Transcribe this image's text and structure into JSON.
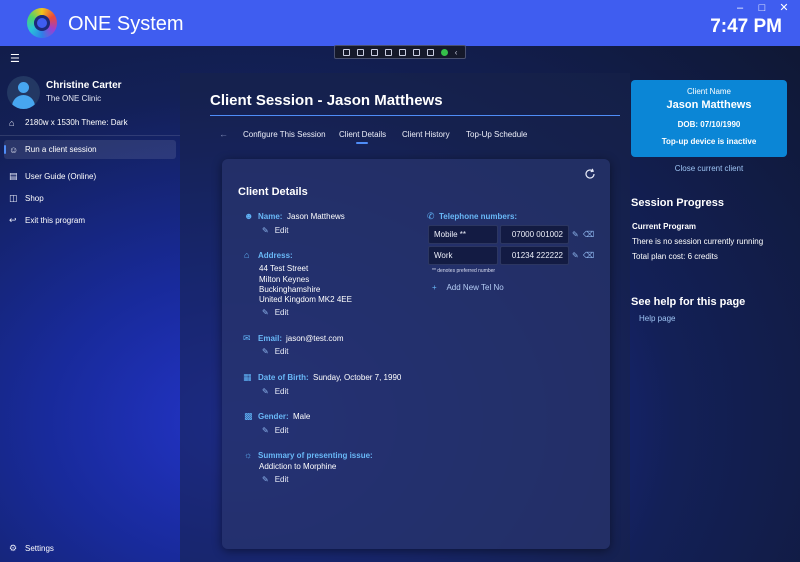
{
  "app": {
    "title": "ONE System",
    "clock": "7:47 PM"
  },
  "sidebar": {
    "user_name": "Christine Carter",
    "clinic": "The ONE Clinic",
    "items": [
      {
        "label": "2180w x 1530h Theme: Dark",
        "icon": "home-icon"
      },
      {
        "label": "Run a client session",
        "icon": "person-settings-icon"
      },
      {
        "label": "User Guide (Online)",
        "icon": "book-icon"
      },
      {
        "label": "Shop",
        "icon": "cart-icon"
      },
      {
        "label": "Exit this program",
        "icon": "exit-icon"
      }
    ],
    "settings_label": "Settings"
  },
  "main": {
    "title": "Client Session - Jason Matthews",
    "tabs": [
      {
        "label": "Configure This Session"
      },
      {
        "label": "Client Details"
      },
      {
        "label": "Client History"
      },
      {
        "label": "Top-Up Schedule"
      }
    ],
    "active_tab": "Client Details",
    "card_title": "Client Details",
    "edit_label": "Edit",
    "fields": {
      "name": {
        "label": "Name:",
        "value": "Jason Matthews"
      },
      "address": {
        "label": "Address:",
        "lines": [
          "44 Test Street",
          "Milton Keynes",
          "Buckinghamshire",
          "United Kingdom MK2 4EE"
        ]
      },
      "email": {
        "label": "Email:",
        "value": "jason@test.com"
      },
      "dob": {
        "label": "Date of Birth:",
        "value": "Sunday, October 7, 1990"
      },
      "gender": {
        "label": "Gender:",
        "value": "Male"
      },
      "issue": {
        "label": "Summary of presenting issue:",
        "value": "Addiction to Morphine"
      }
    },
    "telephone": {
      "label": "Telephone numbers:",
      "rows": [
        {
          "type": "Mobile **",
          "number": "07000 001002"
        },
        {
          "type": "Work",
          "number": "01234 222222"
        }
      ],
      "note": "** denotes preferred number",
      "add_label": "Add New Tel No"
    }
  },
  "client_card": {
    "heading": "Client Name",
    "name": "Jason Matthews",
    "dob": "DOB: 07/10/1990",
    "topup": "Top-up device is inactive",
    "close_label": "Close current client"
  },
  "session_progress": {
    "title": "Session Progress",
    "subtitle": "Current Program",
    "status": "There is no session currently running",
    "cost": "Total plan cost: 6 credits"
  },
  "help": {
    "title": "See help for this page",
    "link": "Help page"
  },
  "colors": {
    "titlebar": "#3f5df0",
    "accent": "#4f8df7",
    "label_blue": "#69b8f7",
    "client_card": "#0b86d6"
  }
}
